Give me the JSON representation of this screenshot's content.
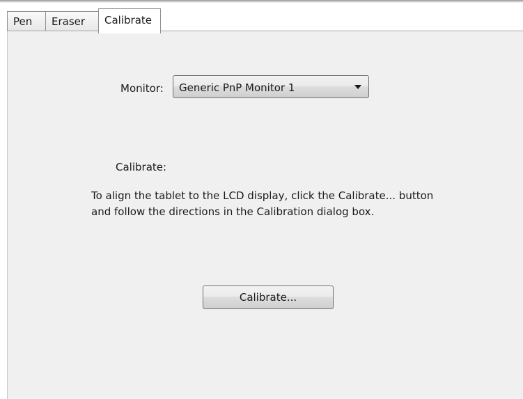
{
  "tabs": [
    {
      "label": "Pen",
      "selected": false
    },
    {
      "label": "Eraser",
      "selected": false
    },
    {
      "label": "Calibrate",
      "selected": true
    }
  ],
  "monitor": {
    "label": "Monitor:",
    "selected_value": "Generic PnP Monitor 1"
  },
  "calibrate_section": {
    "label": "Calibrate:",
    "instructions_line1": "To align the tablet to the LCD display, click the Calibrate... button",
    "instructions_line2": "and follow the directions in the Calibration dialog box.",
    "button_label": "Calibrate..."
  },
  "icons": {
    "dropdown": "chevron-down-icon"
  },
  "colors": {
    "panel_background": "#f0f0f0",
    "border": "#8e8f8f"
  }
}
